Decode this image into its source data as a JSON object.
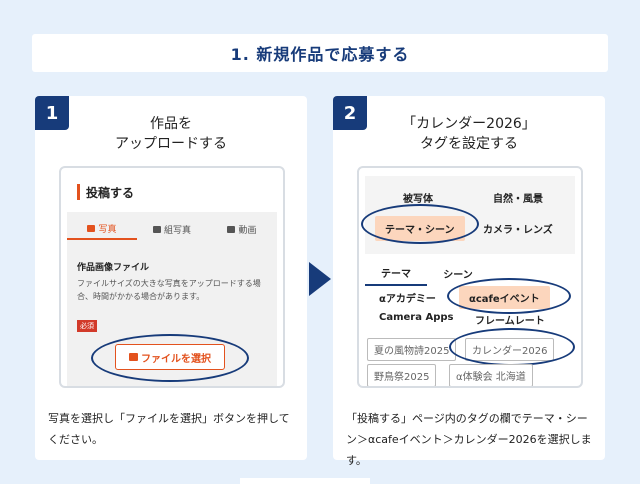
{
  "header": {
    "title": "1. 新規作品で応募する"
  },
  "step1": {
    "number": "1",
    "title_line1": "作品を",
    "title_line2": "アップロードする",
    "screen": {
      "heading": "投稿する",
      "tabs": [
        "写真",
        "組写真",
        "動画"
      ],
      "label": "作品画像ファイル",
      "note": "ファイルサイズの大きな写真をアップロードする場合、時間がかかる場合があります。",
      "required": "必須",
      "file_button": "ファイルを選択"
    },
    "description": "写真を選択し「ファイルを選択」ボタンを押してください。"
  },
  "step2": {
    "number": "2",
    "title_line1": "「カレンダー2026」",
    "title_line2": "タグを設定する",
    "screen": {
      "categories": [
        "被写体",
        "自然・風景",
        "テーマ・シーン",
        "カメラ・レンズ"
      ],
      "subtabs": [
        "テーマ",
        "シーン"
      ],
      "tags": [
        "αアカデミー",
        "αcafeイベント",
        "Camera Apps",
        "フレームレート"
      ],
      "chips": [
        "夏の風物詩2025",
        "カレンダー2026",
        "野鳥祭2025",
        "α体験会 北海道"
      ]
    },
    "description": "「投稿する」ページ内のタグの欄でテーマ・シーン＞αcafeイベント＞カレンダー2026を選択します。"
  }
}
